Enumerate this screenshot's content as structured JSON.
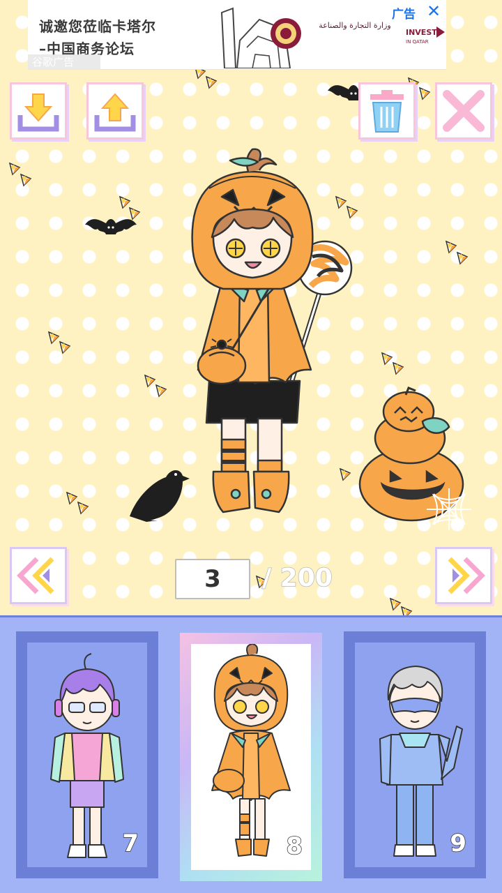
{
  "ad": {
    "headline_line1": "诚邀您莅临卡塔尔",
    "headline_line2": "–中国商务论坛",
    "ad_label": "广告",
    "sublabel": "谷歌广告",
    "ministry_text": "وزارة التجارة والصناعة",
    "invest_logo_text": "INVEST",
    "invest_logo_sub": "IN QATAR"
  },
  "toolbar": {
    "import_icon": "download-tray-icon",
    "export_icon": "upload-tray-icon",
    "delete_icon": "trash-can-icon",
    "close_icon": "close-x-icon"
  },
  "navigation": {
    "prev_icon": "double-chevron-left-icon",
    "next_icon": "double-chevron-right-icon",
    "current_page": "3",
    "total_label": "/ 200"
  },
  "slots": [
    {
      "number": "7",
      "character": "purple-hair-jacket-character"
    },
    {
      "number": "8",
      "character": "pumpkin-hood-character",
      "selected": true
    },
    {
      "number": "9",
      "character": "denim-masked-character"
    }
  ],
  "colors": {
    "background": "#fff2c2",
    "pumpkin": "#f7a64a",
    "panel": "#a3b4f6",
    "panel_frame": "#6b7fd7",
    "accent_pink": "#f7c6dc"
  }
}
